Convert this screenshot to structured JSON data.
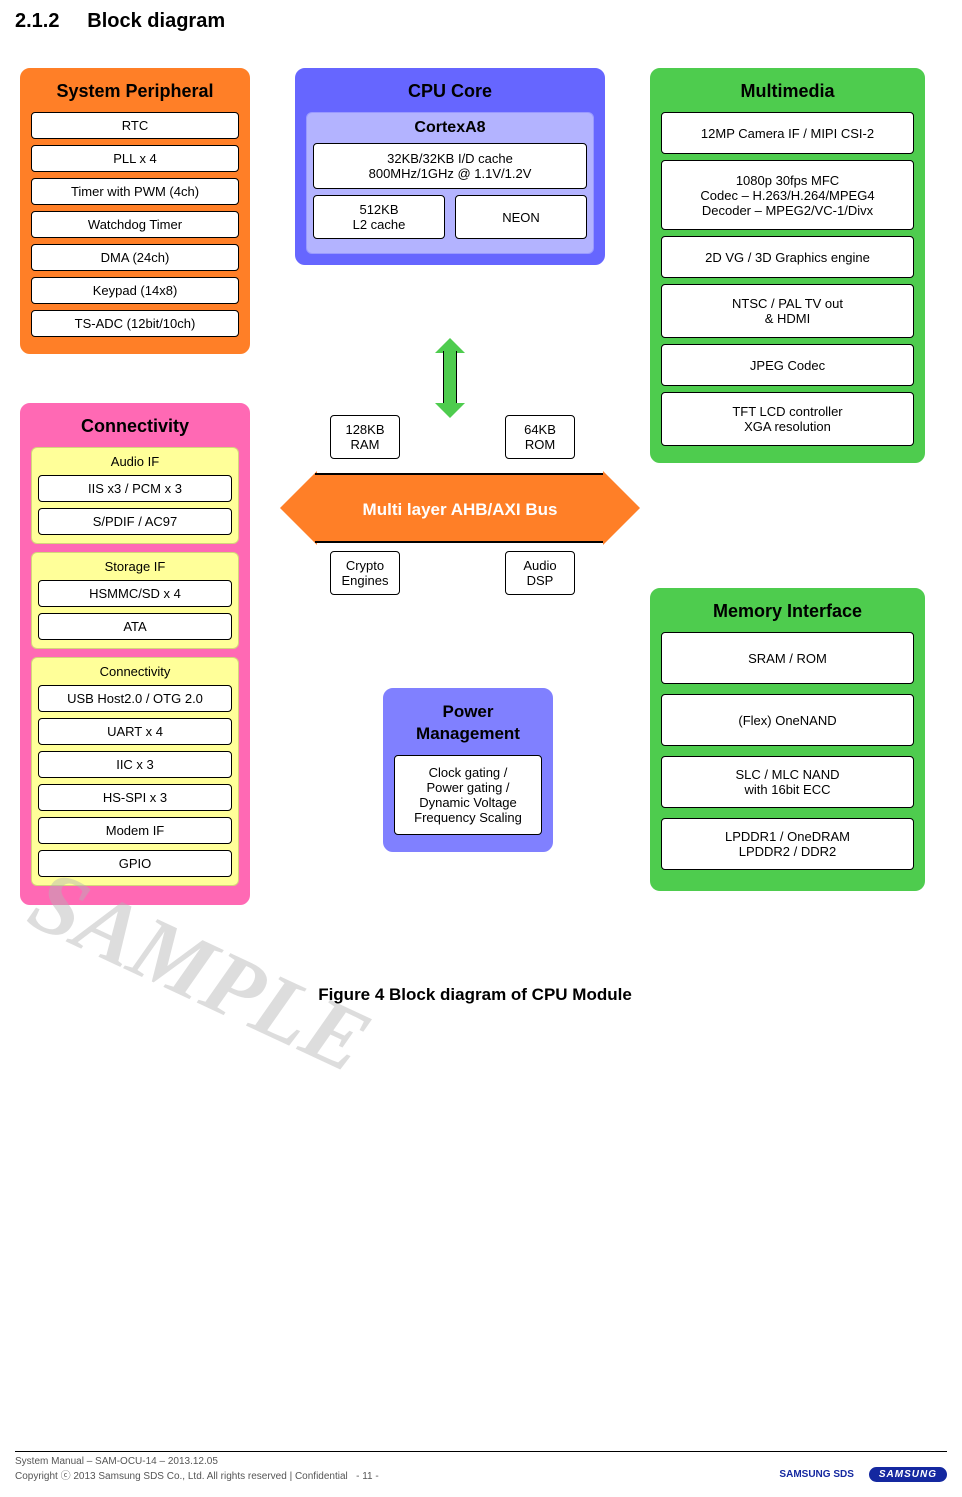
{
  "section": {
    "number": "2.1.2",
    "title": "Block diagram"
  },
  "diagram": {
    "sys_periph": {
      "title": "System Peripheral",
      "items": [
        "RTC",
        "PLL x 4",
        "Timer with PWM (4ch)",
        "Watchdog Timer",
        "DMA (24ch)",
        "Keypad (14x8)",
        "TS-ADC (12bit/10ch)"
      ]
    },
    "connectivity": {
      "title": "Connectivity",
      "audio": {
        "title": "Audio IF",
        "items": [
          "IIS x3 / PCM x 3",
          "S/PDIF / AC97"
        ]
      },
      "storage": {
        "title": "Storage IF",
        "items": [
          "HSMMC/SD x 4",
          "ATA"
        ]
      },
      "conn": {
        "title": "Connectivity",
        "items": [
          "USB Host2.0 / OTG 2.0",
          "UART x 4",
          "IIC x 3",
          "HS-SPI x 3",
          "Modem IF",
          "GPIO"
        ]
      }
    },
    "cpu": {
      "title": "CPU Core",
      "core_name": "CortexA8",
      "cache": "32KB/32KB I/D cache\n800MHz/1GHz @ 1.1V/1.2V",
      "l2": "512KB\nL2 cache",
      "neon": "NEON"
    },
    "multimedia": {
      "title": "Multimedia",
      "items": [
        "12MP Camera IF / MIPI CSI-2",
        "1080p 30fps MFC\nCodec – H.263/H.264/MPEG4\nDecoder – MPEG2/VC-1/Divx",
        "2D VG / 3D Graphics engine",
        "NTSC / PAL TV out\n& HDMI",
        "JPEG Codec",
        "TFT LCD controller\nXGA resolution"
      ]
    },
    "memory": {
      "title": "Memory Interface",
      "items": [
        "SRAM / ROM",
        "(Flex) OneNAND",
        "SLC / MLC NAND\nwith 16bit ECC",
        "LPDDR1 / OneDRAM\nLPDDR2 / DDR2"
      ]
    },
    "power": {
      "title": "Power\nManagement",
      "item": "Clock gating /\nPower gating /\nDynamic Voltage\nFrequency Scaling"
    },
    "bus": {
      "label": "Multi layer AHB/AXI Bus",
      "ram": "128KB\nRAM",
      "rom": "64KB\nROM",
      "crypto": "Crypto\nEngines",
      "dsp": "Audio\nDSP"
    }
  },
  "caption": "Figure  4  Block diagram  of  CPU Module",
  "footer": {
    "line1": "System Manual – SAM-OCU-14 – 2013.12.05",
    "line2": "Copyright ⓒ 2013 Samsung SDS Co., Ltd. All rights reserved   |   Confidential",
    "page": "- 11 -",
    "logo1": "SAMSUNG SDS",
    "logo2": "SAMSUNG"
  },
  "watermark": "SAMPLE"
}
